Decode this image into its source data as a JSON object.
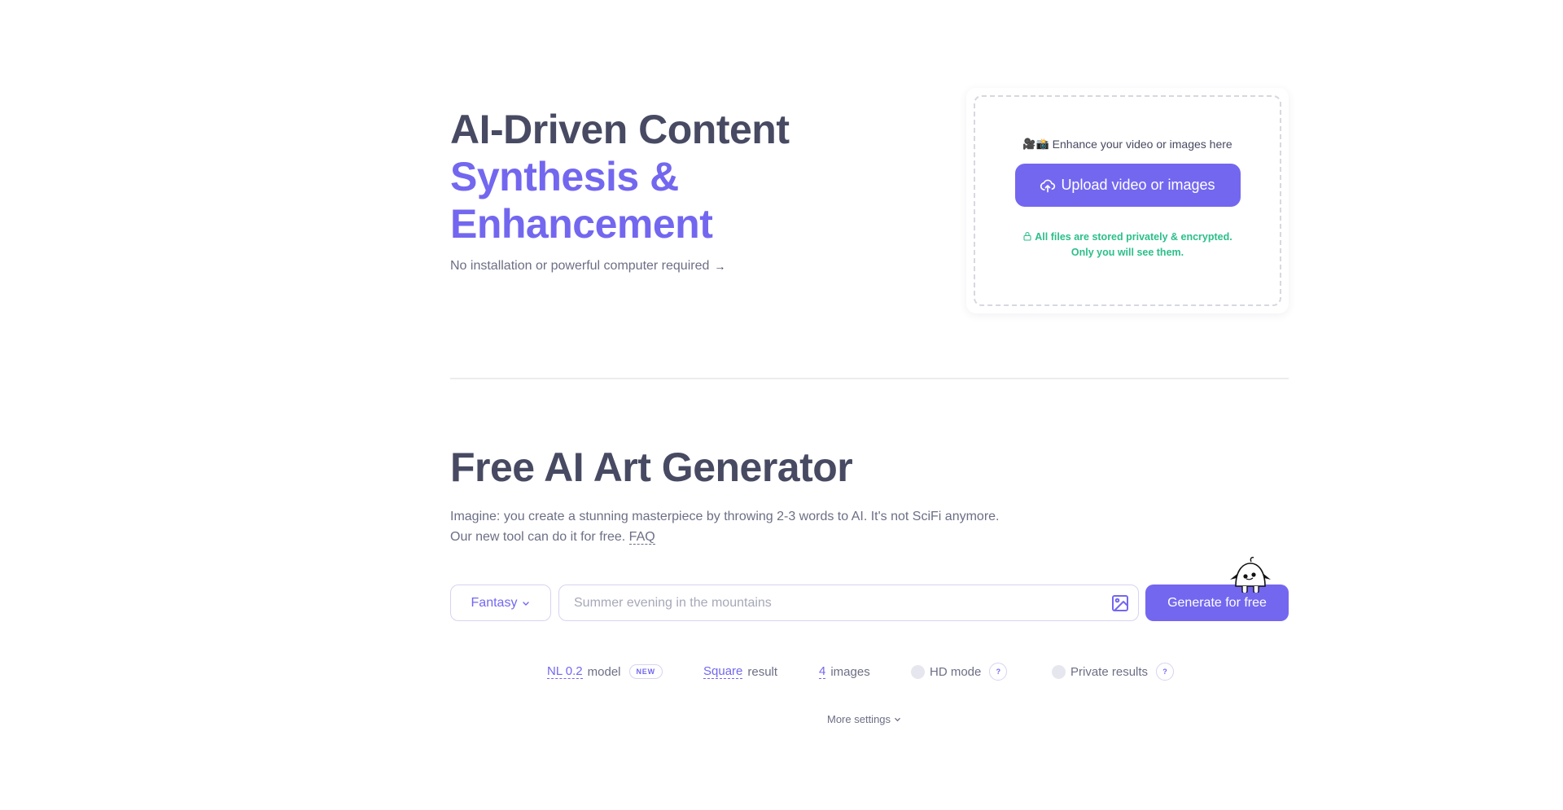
{
  "hero": {
    "title_line1": "AI-Driven Content",
    "title_line2": "Synthesis &",
    "title_line3": "Enhancement",
    "subtitle": "No installation or powerful computer required",
    "subtitle_arrow": "→"
  },
  "upload": {
    "caption_emoji": "🎥📸",
    "caption": "Enhance your video or images here",
    "button_label": "Upload video or images",
    "privacy_line1": "All files are stored privately & encrypted.",
    "privacy_line2": "Only you will see them."
  },
  "generator": {
    "title": "Free AI Art Generator",
    "desc_line1": "Imagine: you create a stunning masterpiece by throwing 2-3 words to AI. It's not SciFi anymore.",
    "desc_line2": "Our new tool can do it for free.",
    "faq_link": "FAQ",
    "style_value": "Fantasy",
    "prompt_value": "",
    "prompt_placeholder": "Summer evening in the mountains",
    "generate_label": "Generate for free"
  },
  "options": {
    "model_value": "NL 0.2",
    "model_label": "model",
    "model_badge": "NEW",
    "aspect_value": "Square",
    "aspect_label": "result",
    "count_value": "4",
    "count_label": "images",
    "hd_label": "HD mode",
    "hd_enabled": false,
    "private_label": "Private results",
    "private_enabled": false,
    "help_glyph": "?",
    "more_settings": "More settings"
  },
  "colors": {
    "accent": "#7367f0",
    "text": "#474a62",
    "muted": "#6c6f85",
    "success": "#2bbf8a"
  }
}
